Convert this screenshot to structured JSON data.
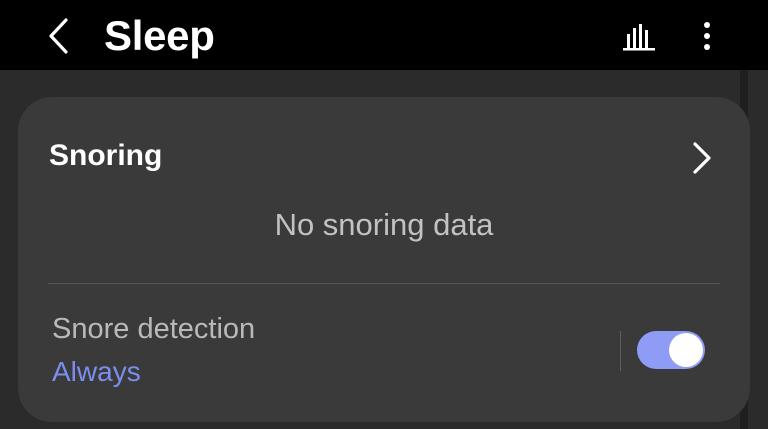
{
  "app_bar": {
    "title": "Sleep",
    "icons": {
      "back": "back-arrow-icon",
      "chart": "bar-chart-icon",
      "more": "more-vertical-icon"
    }
  },
  "snoring_card": {
    "title": "Snoring",
    "empty_message": "No snoring data",
    "snore_detection": {
      "label": "Snore detection",
      "value": "Always",
      "enabled": true
    }
  },
  "colors": {
    "app_bar_bg": "#000000",
    "screen_bg": "#2b2b2b",
    "card_bg": "#3a3a3a",
    "accent": "#7b8ef0",
    "toggle_track": "#8e9cf5"
  }
}
